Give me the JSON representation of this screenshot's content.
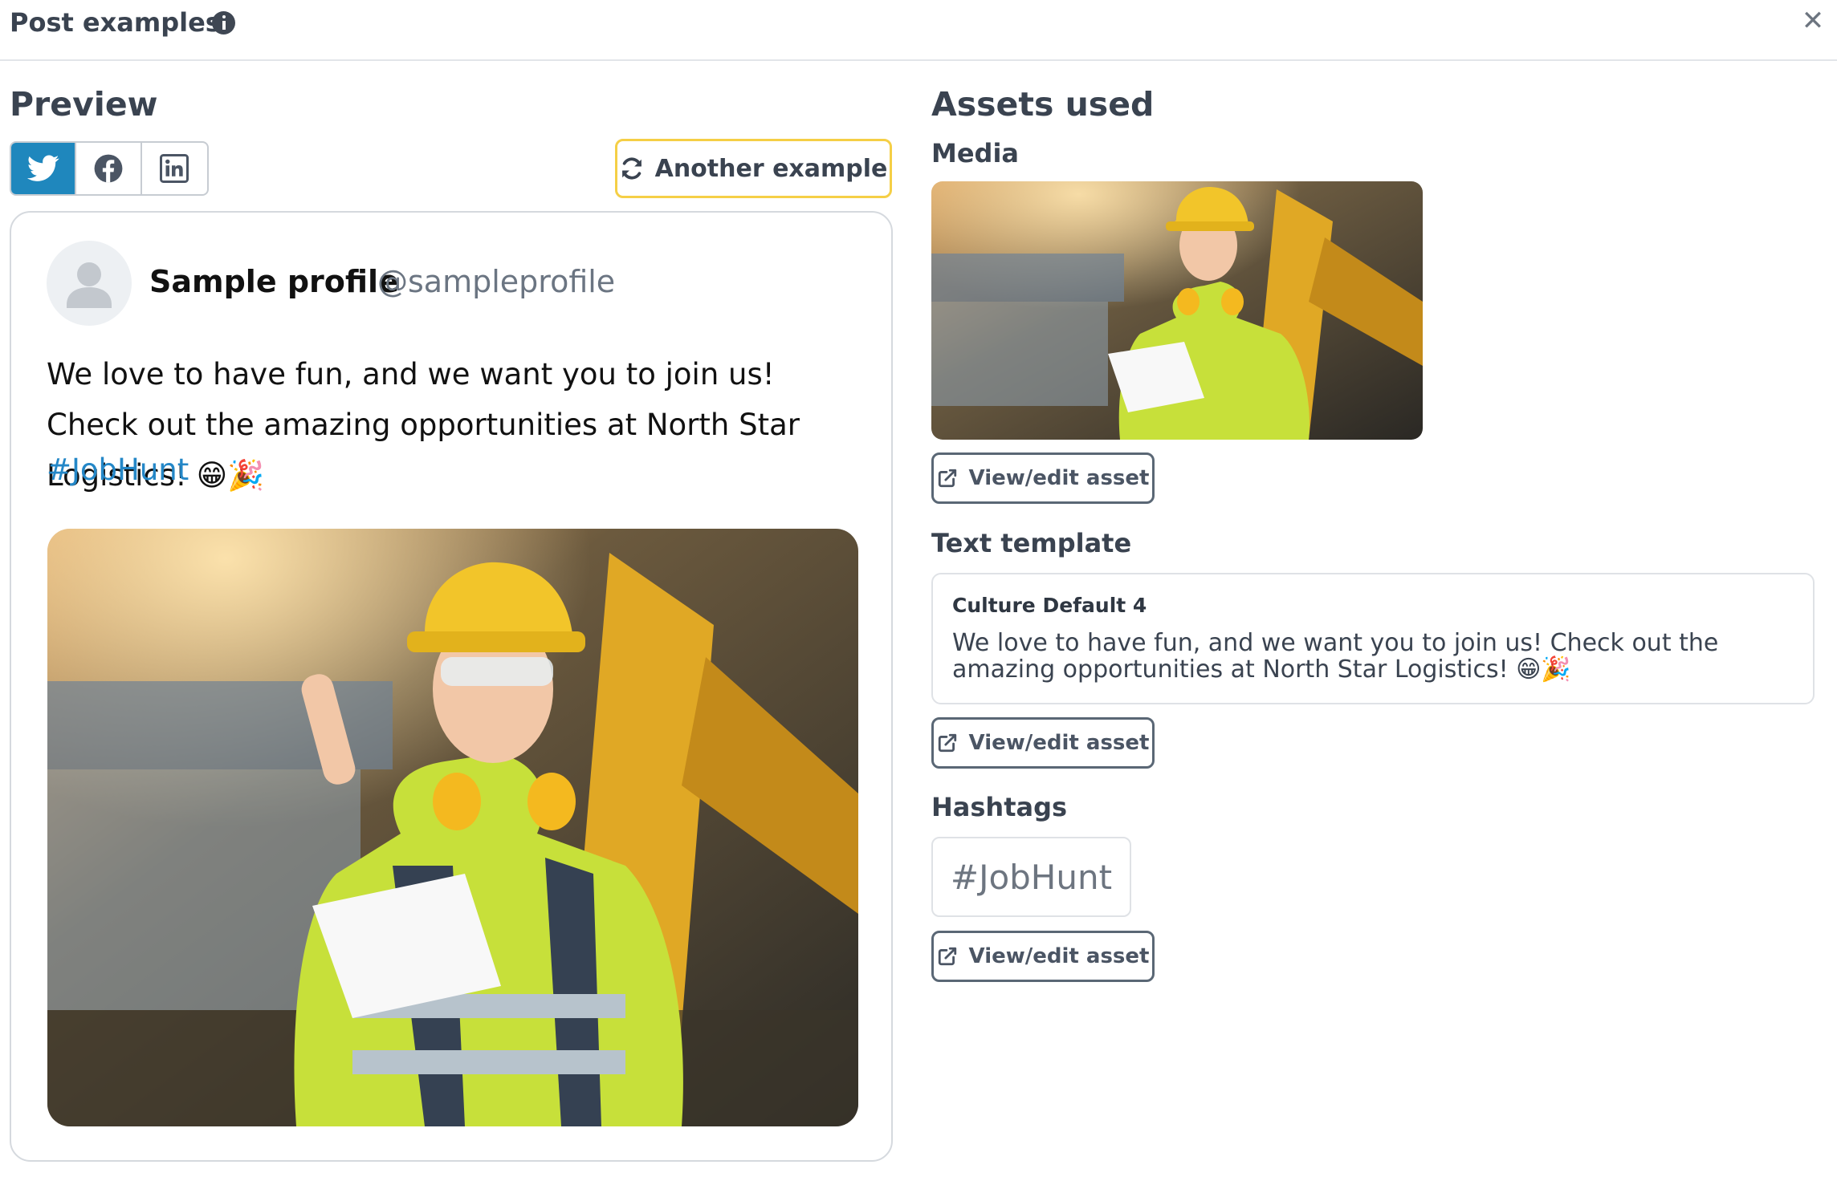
{
  "header": {
    "title": "Post examples"
  },
  "preview": {
    "heading": "Preview",
    "tabs": [
      {
        "icon": "twitter-icon",
        "active": true
      },
      {
        "icon": "facebook-icon",
        "active": false
      },
      {
        "icon": "linkedin-icon",
        "active": false
      }
    ],
    "another_example_label": "Another example",
    "profile_name": "Sample profile",
    "profile_handle": "@sampleprofile",
    "post_text": "We love to have fun, and we want you to join us! Check out the amazing opportunities at North Star Logistics! 😁🎉",
    "post_hashtag": "#JobHunt"
  },
  "assets": {
    "heading": "Assets used",
    "media_heading": "Media",
    "view_edit_label": "View/edit asset",
    "text_template_heading": "Text template",
    "template_title": "Culture Default 4",
    "template_body": "We love to have fun, and we want you to join us! Check out the amazing opportunities at North Star Logistics! 😁🎉",
    "hashtags_heading": "Hashtags",
    "hashtag": "#JobHunt"
  },
  "colors": {
    "twitter_active": "#1f87bd",
    "accent_yellow": "#f5cf46",
    "hashtag_blue": "#2487c7"
  }
}
